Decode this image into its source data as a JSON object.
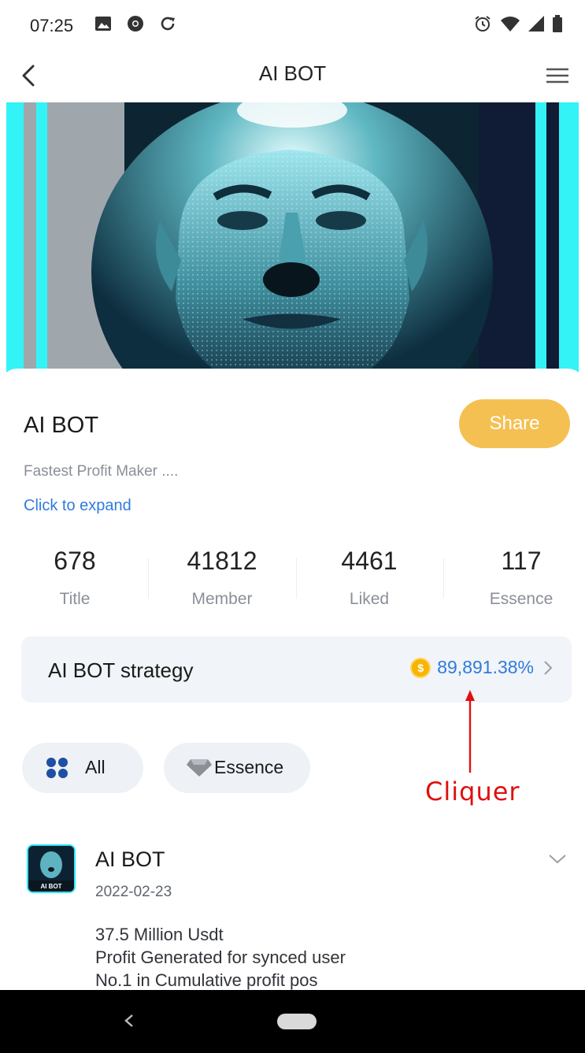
{
  "status_bar": {
    "time": "07:25"
  },
  "nav": {
    "title": "AI BOT"
  },
  "group": {
    "name": "AI BOT",
    "share_label": "Share",
    "description": "Fastest Profit Maker ....",
    "expand_label": "Click to expand"
  },
  "stats": [
    {
      "value": "678",
      "label": "Title"
    },
    {
      "value": "41812",
      "label": "Member"
    },
    {
      "value": "4461",
      "label": "Liked"
    },
    {
      "value": "117",
      "label": "Essence"
    }
  ],
  "strategy": {
    "name": "AI BOT  strategy",
    "value": "89,891.38%",
    "coin_symbol": "$"
  },
  "filters": {
    "all_label": "All",
    "essence_label": "Essence"
  },
  "annotation": {
    "text": "Cliquer",
    "color": "#e01010"
  },
  "post": {
    "author": "AI BOT",
    "date": "2022-02-23",
    "avatar_text": "AI BOT",
    "lines": [
      "37.5 Million Usdt",
      "Profit Generated for synced user",
      "No.1 in Cumulative profit pos"
    ]
  },
  "colors": {
    "accent": "#f5c052",
    "link": "#2f7bdc",
    "muted": "#8a8f98",
    "filter_bg": "#eef1f5"
  }
}
